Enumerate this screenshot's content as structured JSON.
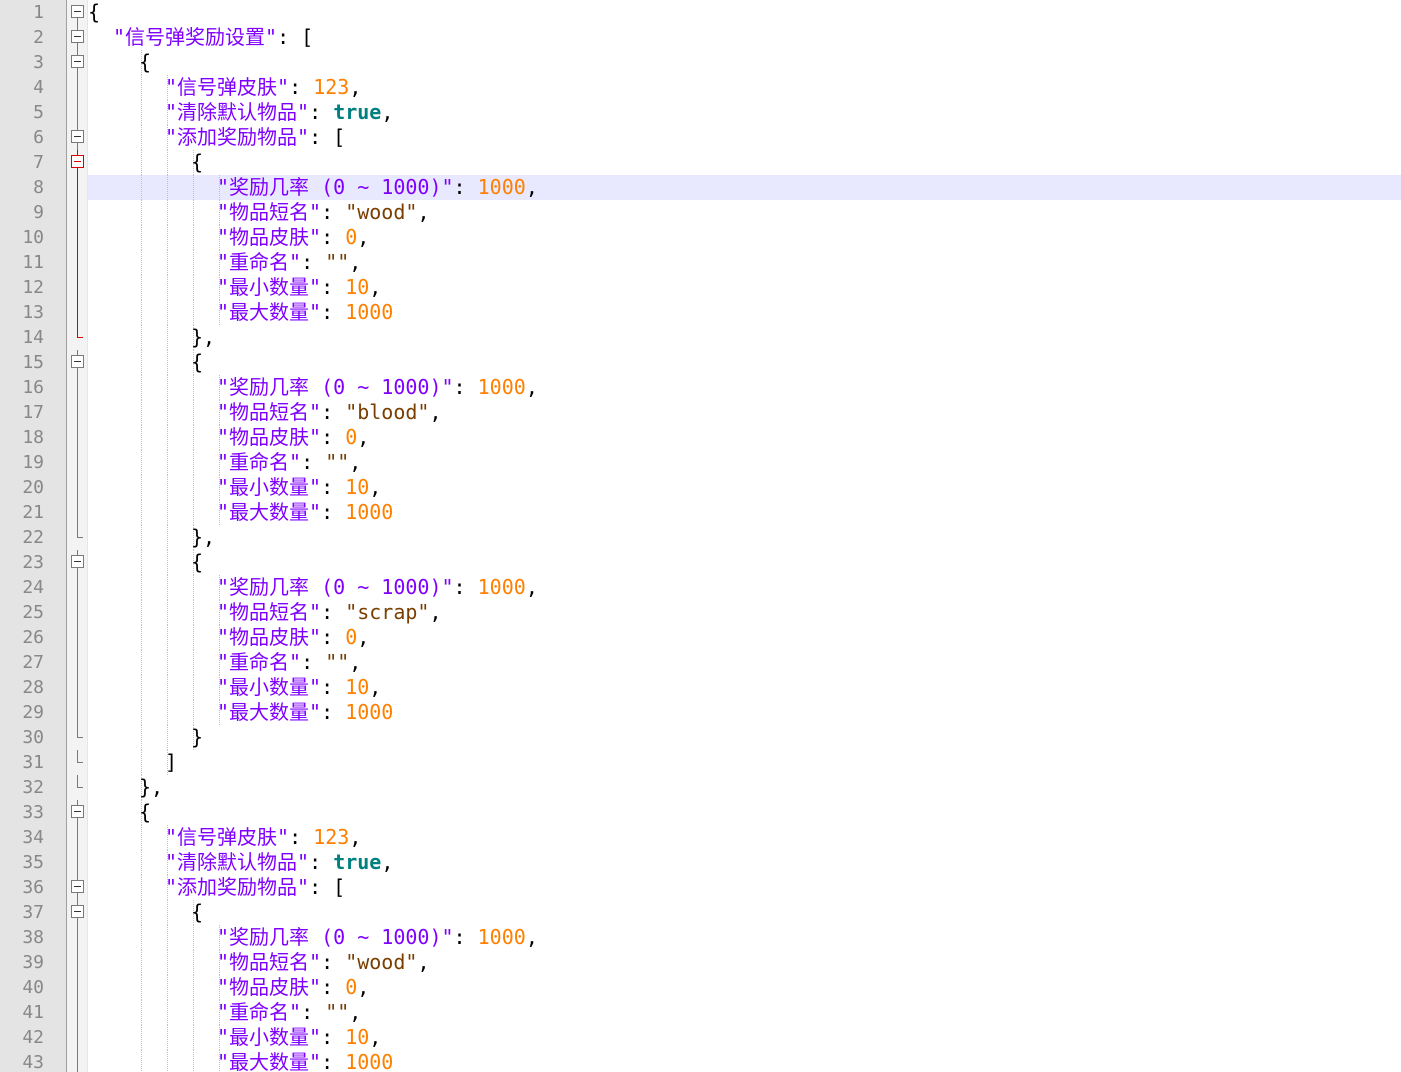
{
  "editor": {
    "language": "JSON",
    "current_line": 8
  },
  "lines": [
    {
      "n": "1",
      "indent": 0,
      "fold": "first",
      "tokens": [
        {
          "t": "p",
          "v": "{"
        }
      ]
    },
    {
      "n": "2",
      "indent": 1,
      "fold": "open",
      "tokens": [
        {
          "t": "k",
          "v": "\"信号弹奖励设置\""
        },
        {
          "t": "p",
          "v": ": ["
        }
      ]
    },
    {
      "n": "3",
      "indent": 2,
      "fold": "open",
      "tokens": [
        {
          "t": "p",
          "v": "{"
        }
      ]
    },
    {
      "n": "4",
      "indent": 3,
      "fold": "line",
      "tokens": [
        {
          "t": "k",
          "v": "\"信号弹皮肤\""
        },
        {
          "t": "p",
          "v": ": "
        },
        {
          "t": "n",
          "v": "123"
        },
        {
          "t": "p",
          "v": ","
        }
      ]
    },
    {
      "n": "5",
      "indent": 3,
      "fold": "line",
      "tokens": [
        {
          "t": "k",
          "v": "\"清除默认物品\""
        },
        {
          "t": "p",
          "v": ": "
        },
        {
          "t": "b",
          "v": "true"
        },
        {
          "t": "p",
          "v": ","
        }
      ]
    },
    {
      "n": "6",
      "indent": 3,
      "fold": "open",
      "tokens": [
        {
          "t": "k",
          "v": "\"添加奖励物品\""
        },
        {
          "t": "p",
          "v": ": ["
        }
      ]
    },
    {
      "n": "7",
      "indent": 4,
      "fold": "open-red",
      "tokens": [
        {
          "t": "p",
          "v": "{"
        }
      ]
    },
    {
      "n": "8",
      "indent": 5,
      "fold": "red",
      "tokens": [
        {
          "t": "k",
          "v": "\"奖励几率 (0 ~ 1000)\""
        },
        {
          "t": "p",
          "v": ": "
        },
        {
          "t": "n",
          "v": "1000"
        },
        {
          "t": "p",
          "v": ","
        }
      ]
    },
    {
      "n": "9",
      "indent": 5,
      "fold": "red",
      "tokens": [
        {
          "t": "k",
          "v": "\"物品短名\""
        },
        {
          "t": "p",
          "v": ": "
        },
        {
          "t": "s",
          "v": "\"wood\""
        },
        {
          "t": "p",
          "v": ","
        }
      ]
    },
    {
      "n": "10",
      "indent": 5,
      "fold": "red",
      "tokens": [
        {
          "t": "k",
          "v": "\"物品皮肤\""
        },
        {
          "t": "p",
          "v": ": "
        },
        {
          "t": "n",
          "v": "0"
        },
        {
          "t": "p",
          "v": ","
        }
      ]
    },
    {
      "n": "11",
      "indent": 5,
      "fold": "red",
      "tokens": [
        {
          "t": "k",
          "v": "\"重命名\""
        },
        {
          "t": "p",
          "v": ": "
        },
        {
          "t": "s",
          "v": "\"\""
        },
        {
          "t": "p",
          "v": ","
        }
      ]
    },
    {
      "n": "12",
      "indent": 5,
      "fold": "red",
      "tokens": [
        {
          "t": "k",
          "v": "\"最小数量\""
        },
        {
          "t": "p",
          "v": ": "
        },
        {
          "t": "n",
          "v": "10"
        },
        {
          "t": "p",
          "v": ","
        }
      ]
    },
    {
      "n": "13",
      "indent": 5,
      "fold": "red",
      "tokens": [
        {
          "t": "k",
          "v": "\"最大数量\""
        },
        {
          "t": "p",
          "v": ": "
        },
        {
          "t": "n",
          "v": "1000"
        }
      ]
    },
    {
      "n": "14",
      "indent": 4,
      "fold": "end-red",
      "tokens": [
        {
          "t": "p",
          "v": "},"
        }
      ]
    },
    {
      "n": "15",
      "indent": 4,
      "fold": "open",
      "tokens": [
        {
          "t": "p",
          "v": "{"
        }
      ]
    },
    {
      "n": "16",
      "indent": 5,
      "fold": "line",
      "tokens": [
        {
          "t": "k",
          "v": "\"奖励几率 (0 ~ 1000)\""
        },
        {
          "t": "p",
          "v": ": "
        },
        {
          "t": "n",
          "v": "1000"
        },
        {
          "t": "p",
          "v": ","
        }
      ]
    },
    {
      "n": "17",
      "indent": 5,
      "fold": "line",
      "tokens": [
        {
          "t": "k",
          "v": "\"物品短名\""
        },
        {
          "t": "p",
          "v": ": "
        },
        {
          "t": "s",
          "v": "\"blood\""
        },
        {
          "t": "p",
          "v": ","
        }
      ]
    },
    {
      "n": "18",
      "indent": 5,
      "fold": "line",
      "tokens": [
        {
          "t": "k",
          "v": "\"物品皮肤\""
        },
        {
          "t": "p",
          "v": ": "
        },
        {
          "t": "n",
          "v": "0"
        },
        {
          "t": "p",
          "v": ","
        }
      ]
    },
    {
      "n": "19",
      "indent": 5,
      "fold": "line",
      "tokens": [
        {
          "t": "k",
          "v": "\"重命名\""
        },
        {
          "t": "p",
          "v": ": "
        },
        {
          "t": "s",
          "v": "\"\""
        },
        {
          "t": "p",
          "v": ","
        }
      ]
    },
    {
      "n": "20",
      "indent": 5,
      "fold": "line",
      "tokens": [
        {
          "t": "k",
          "v": "\"最小数量\""
        },
        {
          "t": "p",
          "v": ": "
        },
        {
          "t": "n",
          "v": "10"
        },
        {
          "t": "p",
          "v": ","
        }
      ]
    },
    {
      "n": "21",
      "indent": 5,
      "fold": "line",
      "tokens": [
        {
          "t": "k",
          "v": "\"最大数量\""
        },
        {
          "t": "p",
          "v": ": "
        },
        {
          "t": "n",
          "v": "1000"
        }
      ]
    },
    {
      "n": "22",
      "indent": 4,
      "fold": "end",
      "tokens": [
        {
          "t": "p",
          "v": "},"
        }
      ]
    },
    {
      "n": "23",
      "indent": 4,
      "fold": "open",
      "tokens": [
        {
          "t": "p",
          "v": "{"
        }
      ]
    },
    {
      "n": "24",
      "indent": 5,
      "fold": "line",
      "tokens": [
        {
          "t": "k",
          "v": "\"奖励几率 (0 ~ 1000)\""
        },
        {
          "t": "p",
          "v": ": "
        },
        {
          "t": "n",
          "v": "1000"
        },
        {
          "t": "p",
          "v": ","
        }
      ]
    },
    {
      "n": "25",
      "indent": 5,
      "fold": "line",
      "tokens": [
        {
          "t": "k",
          "v": "\"物品短名\""
        },
        {
          "t": "p",
          "v": ": "
        },
        {
          "t": "s",
          "v": "\"scrap\""
        },
        {
          "t": "p",
          "v": ","
        }
      ]
    },
    {
      "n": "26",
      "indent": 5,
      "fold": "line",
      "tokens": [
        {
          "t": "k",
          "v": "\"物品皮肤\""
        },
        {
          "t": "p",
          "v": ": "
        },
        {
          "t": "n",
          "v": "0"
        },
        {
          "t": "p",
          "v": ","
        }
      ]
    },
    {
      "n": "27",
      "indent": 5,
      "fold": "line",
      "tokens": [
        {
          "t": "k",
          "v": "\"重命名\""
        },
        {
          "t": "p",
          "v": ": "
        },
        {
          "t": "s",
          "v": "\"\""
        },
        {
          "t": "p",
          "v": ","
        }
      ]
    },
    {
      "n": "28",
      "indent": 5,
      "fold": "line",
      "tokens": [
        {
          "t": "k",
          "v": "\"最小数量\""
        },
        {
          "t": "p",
          "v": ": "
        },
        {
          "t": "n",
          "v": "10"
        },
        {
          "t": "p",
          "v": ","
        }
      ]
    },
    {
      "n": "29",
      "indent": 5,
      "fold": "line",
      "tokens": [
        {
          "t": "k",
          "v": "\"最大数量\""
        },
        {
          "t": "p",
          "v": ": "
        },
        {
          "t": "n",
          "v": "1000"
        }
      ]
    },
    {
      "n": "30",
      "indent": 4,
      "fold": "end",
      "tokens": [
        {
          "t": "p",
          "v": "}"
        }
      ]
    },
    {
      "n": "31",
      "indent": 3,
      "fold": "end",
      "tokens": [
        {
          "t": "p",
          "v": "]"
        }
      ]
    },
    {
      "n": "32",
      "indent": 2,
      "fold": "end",
      "tokens": [
        {
          "t": "p",
          "v": "},"
        }
      ]
    },
    {
      "n": "33",
      "indent": 2,
      "fold": "open",
      "tokens": [
        {
          "t": "p",
          "v": "{"
        }
      ]
    },
    {
      "n": "34",
      "indent": 3,
      "fold": "line",
      "tokens": [
        {
          "t": "k",
          "v": "\"信号弹皮肤\""
        },
        {
          "t": "p",
          "v": ": "
        },
        {
          "t": "n",
          "v": "123"
        },
        {
          "t": "p",
          "v": ","
        }
      ]
    },
    {
      "n": "35",
      "indent": 3,
      "fold": "line",
      "tokens": [
        {
          "t": "k",
          "v": "\"清除默认物品\""
        },
        {
          "t": "p",
          "v": ": "
        },
        {
          "t": "b",
          "v": "true"
        },
        {
          "t": "p",
          "v": ","
        }
      ]
    },
    {
      "n": "36",
      "indent": 3,
      "fold": "open",
      "tokens": [
        {
          "t": "k",
          "v": "\"添加奖励物品\""
        },
        {
          "t": "p",
          "v": ": ["
        }
      ]
    },
    {
      "n": "37",
      "indent": 4,
      "fold": "open",
      "tokens": [
        {
          "t": "p",
          "v": "{"
        }
      ]
    },
    {
      "n": "38",
      "indent": 5,
      "fold": "line",
      "tokens": [
        {
          "t": "k",
          "v": "\"奖励几率 (0 ~ 1000)\""
        },
        {
          "t": "p",
          "v": ": "
        },
        {
          "t": "n",
          "v": "1000"
        },
        {
          "t": "p",
          "v": ","
        }
      ]
    },
    {
      "n": "39",
      "indent": 5,
      "fold": "line",
      "tokens": [
        {
          "t": "k",
          "v": "\"物品短名\""
        },
        {
          "t": "p",
          "v": ": "
        },
        {
          "t": "s",
          "v": "\"wood\""
        },
        {
          "t": "p",
          "v": ","
        }
      ]
    },
    {
      "n": "40",
      "indent": 5,
      "fold": "line",
      "tokens": [
        {
          "t": "k",
          "v": "\"物品皮肤\""
        },
        {
          "t": "p",
          "v": ": "
        },
        {
          "t": "n",
          "v": "0"
        },
        {
          "t": "p",
          "v": ","
        }
      ]
    },
    {
      "n": "41",
      "indent": 5,
      "fold": "line",
      "tokens": [
        {
          "t": "k",
          "v": "\"重命名\""
        },
        {
          "t": "p",
          "v": ": "
        },
        {
          "t": "s",
          "v": "\"\""
        },
        {
          "t": "p",
          "v": ","
        }
      ]
    },
    {
      "n": "42",
      "indent": 5,
      "fold": "line",
      "tokens": [
        {
          "t": "k",
          "v": "\"最小数量\""
        },
        {
          "t": "p",
          "v": ": "
        },
        {
          "t": "n",
          "v": "10"
        },
        {
          "t": "p",
          "v": ","
        }
      ]
    },
    {
      "n": "43",
      "indent": 5,
      "fold": "line",
      "tokens": [
        {
          "t": "k",
          "v": "\"最大数量\""
        },
        {
          "t": "p",
          "v": ": "
        },
        {
          "t": "n",
          "v": "1000"
        }
      ]
    }
  ]
}
